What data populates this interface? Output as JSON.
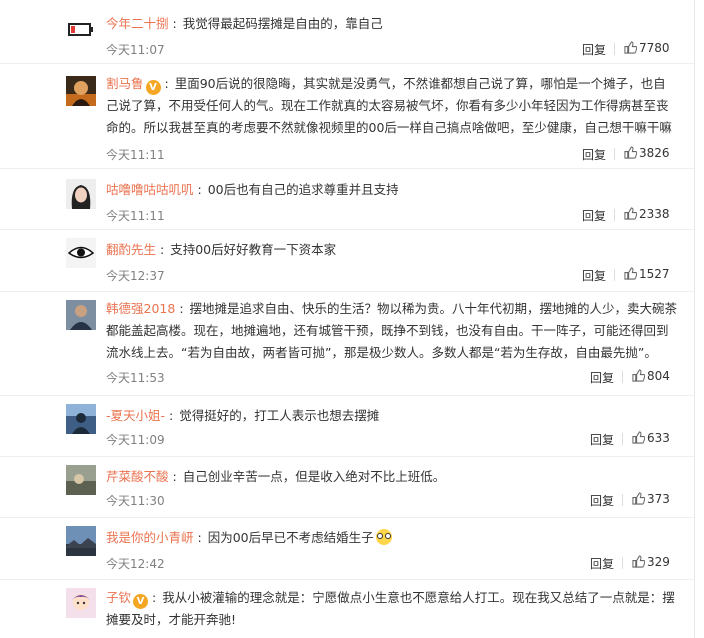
{
  "reply_label": "回复",
  "comments": [
    {
      "user": "今年二十捌",
      "verified": false,
      "text": "我觉得最起码摆摊是自由的，靠自己",
      "time": "今天11:07",
      "likes": "7780",
      "avatar_icon": "battery-low-avatar"
    },
    {
      "user": "割马鲁",
      "verified": true,
      "text": "里面90后说的很隐晦，其实就是没勇气，不然谁都想自己说了算，哪怕是一个摊子，也自己说了算，不用受任何人的气。现在工作就真的太容易被气坏，你看有多少小年轻因为工作得病甚至丧命的。所以我甚至真的考虑要不然就像视频里的00后一样自己搞点啥做吧，至少健康，自己想干嘛干嘛",
      "time": "今天11:11",
      "likes": "3826",
      "avatar_icon": "portrait-avatar"
    },
    {
      "user": "咕噜噜咕咕叽叽",
      "verified": false,
      "text": "00后也有自己的追求尊重并且支持",
      "time": "今天11:11",
      "likes": "2338",
      "avatar_icon": "girl-avatar"
    },
    {
      "user": "翻酌先生",
      "verified": false,
      "text": "支持00后好好教育一下资本家",
      "time": "今天12:37",
      "likes": "1527",
      "avatar_icon": "eye-avatar"
    },
    {
      "user": "韩德强2018",
      "verified": false,
      "text": "摆地摊是追求自由、快乐的生活？物以稀为贵。八十年代初期，摆地摊的人少，卖大碗茶都能盖起高楼。现在，地摊遍地，还有城管干预，既挣不到钱，也没有自由。干一阵子，可能还得回到流水线上去。“若为自由故，两者皆可抛”，那是极少数人。多数人都是“若为生存故，自由最先抛”。",
      "time": "今天11:53",
      "likes": "804",
      "avatar_icon": "man-avatar"
    },
    {
      "user": "-夏天小姐-",
      "verified": false,
      "text": "觉得挺好的，打工人表示也想去摆摊",
      "time": "今天11:09",
      "likes": "633",
      "avatar_icon": "silhouette-avatar"
    },
    {
      "user": "芹菜酸不酸",
      "verified": false,
      "text": "自己创业辛苦一点，但是收入绝对不比上班低。",
      "time": "今天11:30",
      "likes": "373",
      "avatar_icon": "photo-avatar"
    },
    {
      "user": "我是你的小青岍",
      "verified": false,
      "text": "因为00后早已不考虑结婚生子",
      "time": "今天12:42",
      "likes": "329",
      "avatar_icon": "sky-avatar",
      "emoji": "glasses-emoji"
    },
    {
      "user": "子钦",
      "verified": true,
      "text": "我从小被灌输的理念就是：宁愿做点小生意也不愿意给人打工。现在我又总结了一点就是：摆摊要及时，才能开奔驰!",
      "time": "",
      "likes": "",
      "avatar_icon": "cartoon-avatar"
    }
  ]
}
